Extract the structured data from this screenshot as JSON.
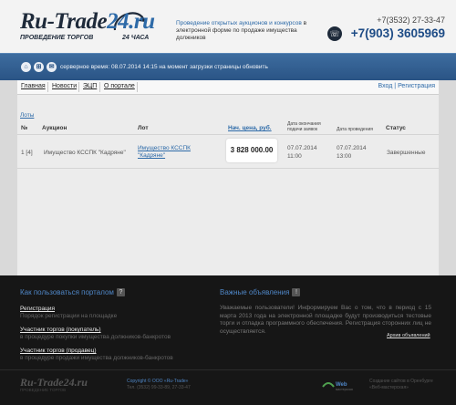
{
  "header": {
    "logo_main_prefix": "Ru-Tr",
    "logo_main_mid": "ade",
    "logo_main_num": "24",
    "logo_main_suffix": ".ru",
    "logo_sub": "ПРОВЕДЕНИЕ ТОРГОВ",
    "logo_sub2": "24 ЧАСА",
    "tagline_accent": "Проведение открытых аукционов и конкурсов",
    "tagline_rest": "в электронной форме по продаже имущества должников",
    "phone1": "+7(3532) 27-33-47",
    "phone2": "+7(903) 3605969"
  },
  "bluebar": {
    "text": "серверное время: 08.07.2014 14:15 на момент загрузки страницы обновить"
  },
  "nav": {
    "items": [
      "Главная",
      "Новости",
      "ЭЦП",
      "О портале"
    ],
    "login": "Вход | Регистрация"
  },
  "content": {
    "breadcrumb": "Лоты",
    "columns": {
      "num": "№",
      "auction": "Аукцион",
      "lot": "Лот",
      "price": "Нач. цена, руб.",
      "deadline": "Дата окончания подачи заявок",
      "date": "Дата проведения",
      "status": "Статус"
    },
    "rows": [
      {
        "num": "1 [4]",
        "auction": "Имущество КССПК \"Кадряне\"",
        "lot": "Имущество КССПК \"Кадряне\"",
        "price": "3 828 000.00",
        "deadline_date": "07.07.2014",
        "deadline_time": "11:00",
        "date": "07.07.2014",
        "time": "13:00",
        "status": "Завершенные"
      }
    ]
  },
  "footer": {
    "how_title": "Как пользоваться порталом",
    "links": [
      {
        "title": "Регистрация",
        "sub": "Порядок регистрации на площадке"
      },
      {
        "title": "Участник торгов (покупатель)",
        "sub": "в процедуре покупки имущества должников-банкротов"
      },
      {
        "title": "Участник торгов (продавец)",
        "sub": "в процедуре продажи имущества должников-банкротов"
      }
    ],
    "news_title": "Важные объявления",
    "news_text": "Уважаемые пользователи! Информируем Вас о том, что в период с 15 марта 2013 года на электронной площадке будут производиться тестовые торги и отладка программного обеспечения. Регистрация сторонних лиц не осуществляется.",
    "archive": "Архив объявлений",
    "copyright": "Copyright © ООО «Ru-Trade»",
    "copyright_phone": "Тел. (3532) 99-33-89, 27-33-47",
    "dev": "Создание сайтов в Оренбурге",
    "dev2": "«Веб-мастерская»"
  }
}
